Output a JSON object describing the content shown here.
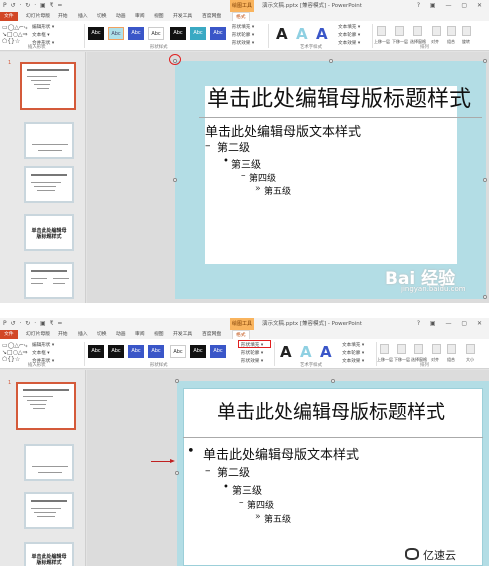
{
  "qat": "P  ↺ · ↻ · ▣ ₹ =",
  "context_tab": "绘图工具",
  "doc_title": "演示文稿.pptx [兼容模式] - PowerPoint",
  "window_controls": "? ▣ — ▢ ✕",
  "tabs": [
    "文件",
    "幻灯片母版",
    "开始",
    "插入",
    "切换",
    "动画",
    "审阅",
    "视图",
    "开发工具",
    "百度网盘",
    "格式"
  ],
  "ribbon": {
    "shapes_glyphs": "▭◯△⌐⤷↘□○△⇒⬠{}☆",
    "shape_cmds": [
      "编辑形状 ▾",
      "文本框 ▾",
      "合并形状 ▾"
    ],
    "group_insert": "插入形状",
    "style_swatches": [
      "Abc",
      "Abc",
      "Abc",
      "Abc",
      "Abc",
      "Abc",
      "Abc"
    ],
    "fill_cmds": [
      "形状填充 ▾",
      "形状轮廓 ▾",
      "形状效果 ▾"
    ],
    "group_styles": "形状样式",
    "wordart_letters": [
      "A",
      "A",
      "A"
    ],
    "text_cmds": [
      "文本填充 ▾",
      "文本轮廓 ▾",
      "文本效果 ▾"
    ],
    "group_wordart": "艺术字样式",
    "arrange_cmds": [
      "上移一层",
      "下移一层",
      "选择窗格",
      "对齐",
      "组合",
      "旋转"
    ],
    "group_arrange": "排列",
    "size_cmds": [
      "大小"
    ]
  },
  "thumbnails": {
    "numbers": [
      "1"
    ],
    "slide2_title": "单击此处编辑母版标题样式"
  },
  "slide": {
    "title": "单击此处编辑母版标题样式",
    "level1": "单击此处编辑母版文本样式",
    "level2": "第二级",
    "level3": "第三级",
    "level4": "第四级",
    "level5": "第五级",
    "bullet1": "•",
    "bullet2": "–",
    "bullet3": "•",
    "bullet4": "–",
    "bullet5": "»"
  },
  "watermark": {
    "logo": "Bai 经验",
    "url": "jingyan.baidu.com",
    "brand2": "亿速云"
  },
  "colors": {
    "file_tab": "#d24726",
    "context_tab": "#f9b45e",
    "slide_bg": "#b3dde5",
    "selection": "#d45a3a",
    "annotation": "#e02020"
  }
}
